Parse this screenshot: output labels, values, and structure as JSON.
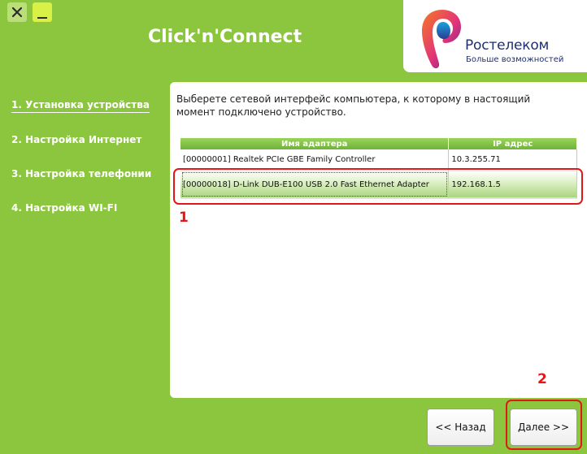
{
  "window": {
    "close_glyph": "✕",
    "minimize_glyph": "_"
  },
  "app": {
    "title": "Click'n'Connect"
  },
  "logo": {
    "name": "Ростелеком",
    "tagline": "Больше возможностей"
  },
  "sidebar": {
    "steps": [
      {
        "label": "1. Установка устройства",
        "active": true
      },
      {
        "label": "2. Настройка Интернет",
        "active": false
      },
      {
        "label": "3. Настройка телефонии",
        "active": false
      },
      {
        "label": "4. Настройка WI-FI",
        "active": false
      }
    ]
  },
  "main": {
    "instruction": "Выберете сетевой интерфейс компьютера, к которому в настоящий момент подключено устройство.",
    "table": {
      "headers": [
        "Имя адаптера",
        "IP адрес"
      ],
      "rows": [
        {
          "name": "[00000001] Realtek PCIe GBE Family Controller",
          "ip": "10.3.255.71",
          "selected": false
        },
        {
          "name": "[00000018] D-Link DUB-E100 USB 2.0 Fast Ethernet Adapter",
          "ip": "192.168.1.5",
          "selected": true
        }
      ]
    }
  },
  "annotations": {
    "label_1": "1",
    "label_2": "2"
  },
  "buttons": {
    "back_label": "<< Назад",
    "next_label": "Далее >>"
  },
  "colors": {
    "background": "#8cc63f",
    "annotation": "#e11818",
    "brand_text": "#1f2f6e"
  }
}
